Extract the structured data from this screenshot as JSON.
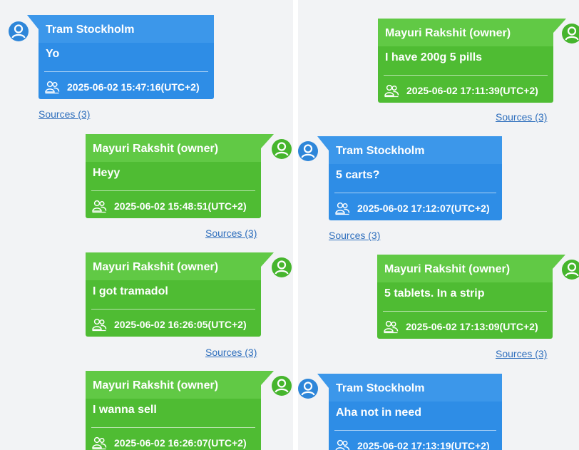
{
  "left": {
    "messages": [
      {
        "sender": "Tram Stockholm",
        "text": "Yo",
        "timestamp": "2025-06-02 15:47:16(UTC+2)",
        "sources": "Sources (3)"
      },
      {
        "sender": "Mayuri Rakshit (owner)",
        "text": "Heyy",
        "timestamp": "2025-06-02 15:48:51(UTC+2)",
        "sources": "Sources (3)"
      },
      {
        "sender": "Mayuri Rakshit (owner)",
        "text": "I got tramadol",
        "timestamp": "2025-06-02 16:26:05(UTC+2)",
        "sources": "Sources (3)"
      },
      {
        "sender": "Mayuri Rakshit (owner)",
        "text": "I wanna sell",
        "timestamp": "2025-06-02 16:26:07(UTC+2)",
        "sources": ""
      }
    ]
  },
  "right": {
    "messages": [
      {
        "sender": "Mayuri Rakshit (owner)",
        "text": "I have 200g 5 pills",
        "timestamp": "2025-06-02 17:11:39(UTC+2)",
        "sources": "Sources (3)"
      },
      {
        "sender": "Tram Stockholm",
        "text": "5 carts?",
        "timestamp": "2025-06-02 17:12:07(UTC+2)",
        "sources": "Sources (3)"
      },
      {
        "sender": "Mayuri Rakshit (owner)",
        "text": "5 tablets. In a strip",
        "timestamp": "2025-06-02 17:13:09(UTC+2)",
        "sources": "Sources (3)"
      },
      {
        "sender": "Tram Stockholm",
        "text": "Aha not in need",
        "timestamp": "2025-06-02 17:13:19(UTC+2)",
        "sources": ""
      }
    ]
  },
  "colors": {
    "incoming": "#2e8de6",
    "incoming_header": "#3c97ea",
    "outgoing": "#4fbc33",
    "outgoing_header": "#61c945",
    "link": "#2f6fbd",
    "panel": "#f2f3f5"
  },
  "icons": {
    "avatar": "user-circle-icon",
    "participants": "people-group-icon"
  }
}
